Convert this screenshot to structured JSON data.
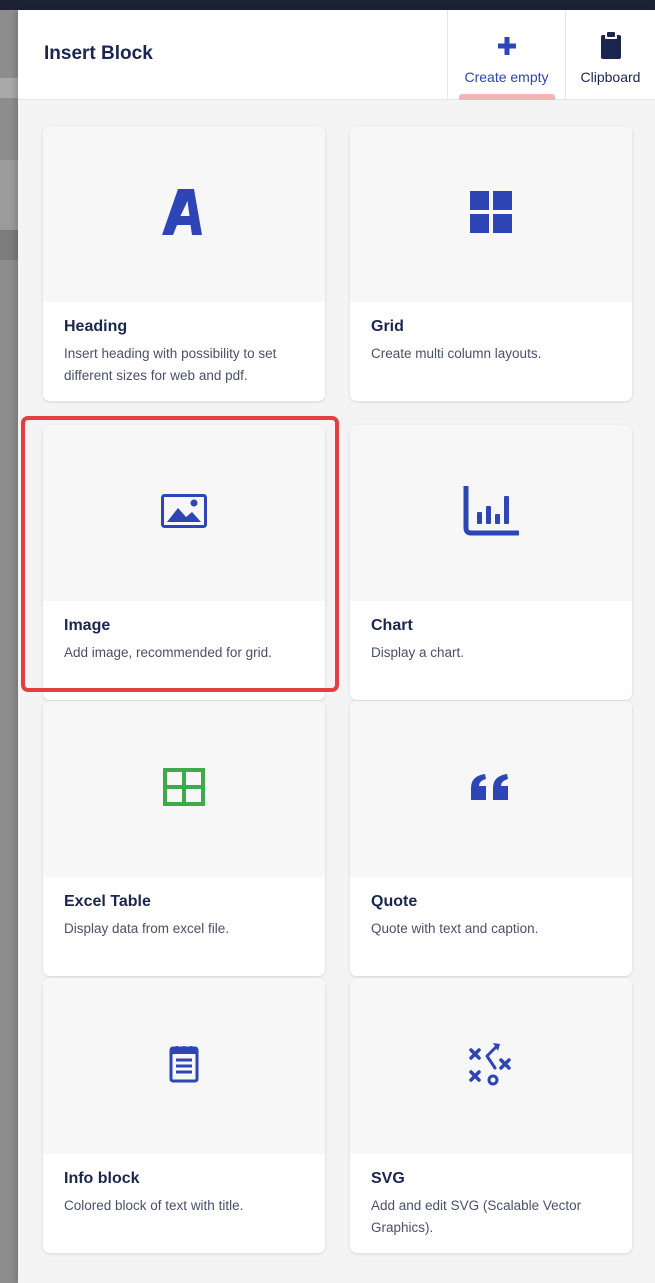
{
  "header": {
    "title": "Insert Block",
    "create_label": "Create empty",
    "clipboard_label": "Clipboard"
  },
  "blocks": [
    {
      "title": "Heading",
      "description": "Insert heading with possibility to set different sizes for web and pdf.",
      "icon": "letter-a-icon"
    },
    {
      "title": "Grid",
      "description": "Create multi column layouts.",
      "icon": "grid-icon"
    },
    {
      "title": "Image",
      "description": "Add image, recommended for grid.",
      "icon": "image-icon",
      "highlighted": true
    },
    {
      "title": "Chart",
      "description": "Display a chart.",
      "icon": "bar-chart-icon"
    },
    {
      "title": "Excel Table",
      "description": "Display data from excel file.",
      "icon": "table-icon"
    },
    {
      "title": "Quote",
      "description": "Quote with text and caption.",
      "icon": "quote-icon"
    },
    {
      "title": "Info block",
      "description": "Colored block of text with title.",
      "icon": "notepad-icon"
    },
    {
      "title": "SVG",
      "description": "Add and edit SVG (Scalable Vector Graphics).",
      "icon": "vector-path-icon"
    }
  ],
  "colors": {
    "accent_blue": "#2d45b5",
    "excel_green": "#3faa4a",
    "title_navy": "#1b264f",
    "highlight_red": "#e53e3e",
    "tab_underline": "#f3b4b4"
  }
}
